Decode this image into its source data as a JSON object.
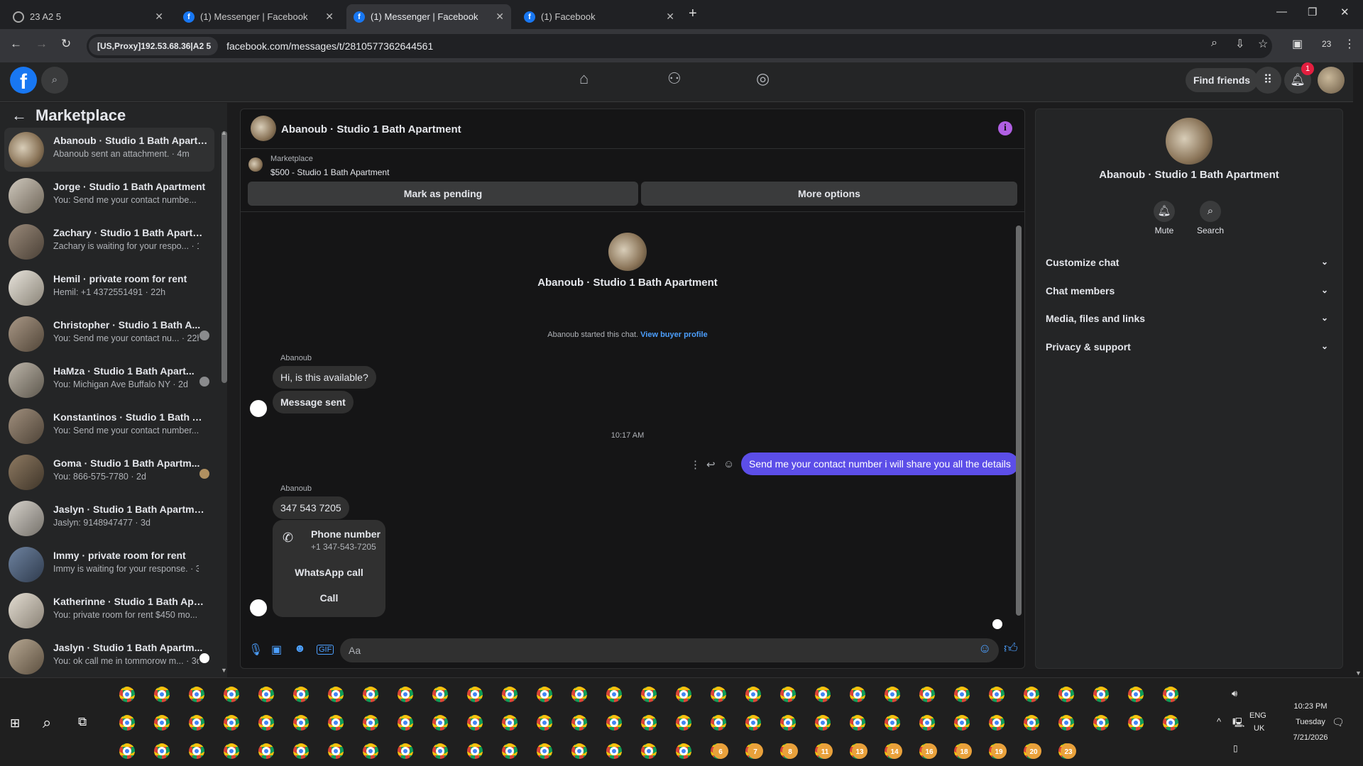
{
  "browser": {
    "tabs": [
      {
        "title": "23 A2 5"
      },
      {
        "title": "(1) Messenger | Facebook"
      },
      {
        "title": "(1) Messenger | Facebook"
      },
      {
        "title": "(1) Facebook"
      }
    ],
    "proxy_label": "[US,Proxy]192.53.68.36|A2 5",
    "url": "facebook.com/messages/t/2810577362644561",
    "profile_badge": "23"
  },
  "header": {
    "find_friends": "Find friends",
    "notif_count": "1"
  },
  "sidebar": {
    "title": "Marketplace",
    "conversations": [
      {
        "name": "Abanoub · Studio 1 Bath Apartm...",
        "sub": "Abanoub sent an attachment. · 4m",
        "selected": true
      },
      {
        "name": "Jorge · Studio 1 Bath Apartment",
        "sub": "You: Send me your contact numbe... · 6m"
      },
      {
        "name": "Zachary · Studio 1 Bath Apartme...",
        "sub": "Zachary is waiting for your respo... · 12h"
      },
      {
        "name": "Hemil · private room for rent",
        "sub": "Hemil: +1 4372551491 · 22h"
      },
      {
        "name": "Christopher · Studio 1 Bath A...",
        "sub": "You: Send me your contact nu... · 22h"
      },
      {
        "name": "HaMza · Studio 1 Bath Apart...",
        "sub": "You: Michigan Ave Buffalo NY · 2d"
      },
      {
        "name": "Konstantinos · Studio 1 Bath Ap...",
        "sub": "You: Send me your contact number... · 2d"
      },
      {
        "name": "Goma · Studio 1 Bath Apartm...",
        "sub": "You: 866-575-7780 · 2d"
      },
      {
        "name": "Jaslyn · Studio 1 Bath Apartment",
        "sub": "Jaslyn: 9148947477 · 3d"
      },
      {
        "name": "Immy · private room for rent",
        "sub": "Immy is waiting for your response. · 3d"
      },
      {
        "name": "Katherinne · Studio 1 Bath Apart...",
        "sub": "You: private room for rent $450 mo... · 3d"
      },
      {
        "name": "Jaslyn · Studio 1 Bath Apartm...",
        "sub": "You: ok call me in tommorow m... · 3d"
      }
    ]
  },
  "chat": {
    "title": "Abanoub · Studio 1 Bath Apartment",
    "marketplace_label": "Marketplace",
    "listing": "$500 - Studio 1 Bath Apartment",
    "mark_pending": "Mark as pending",
    "more_options": "More options",
    "intro_name": "Abanoub · Studio 1 Bath Apartment",
    "started_text": "Abanoub started this chat.",
    "view_buyer": "View buyer profile",
    "sender1": "Abanoub",
    "msg1": "Hi, is this available?",
    "msg2": "Message sent",
    "time_sep": "10:17 AM",
    "my_msg": "Send me your contact number i will share you all the details",
    "sender2": "Abanoub",
    "msg3": "347 543 7205",
    "phone_title": "Phone number",
    "phone_num": "+1 347-543-7205",
    "whatsapp": "WhatsApp call",
    "call": "Call",
    "composer_placeholder": "Aa"
  },
  "right_panel": {
    "name": "Abanoub · Studio 1 Bath Apartment",
    "mute": "Mute",
    "search": "Search",
    "sections": [
      "Customize chat",
      "Chat members",
      "Media, files and links",
      "Privacy & support"
    ]
  },
  "taskbar": {
    "lang1": "ENG",
    "lang2": "UK",
    "time": "10:23 PM",
    "day": "Tuesday",
    "date": "7/21/2026",
    "numbered": [
      "6",
      "7",
      "8",
      "11",
      "13",
      "14",
      "16",
      "18",
      "19",
      "20",
      "23"
    ]
  }
}
